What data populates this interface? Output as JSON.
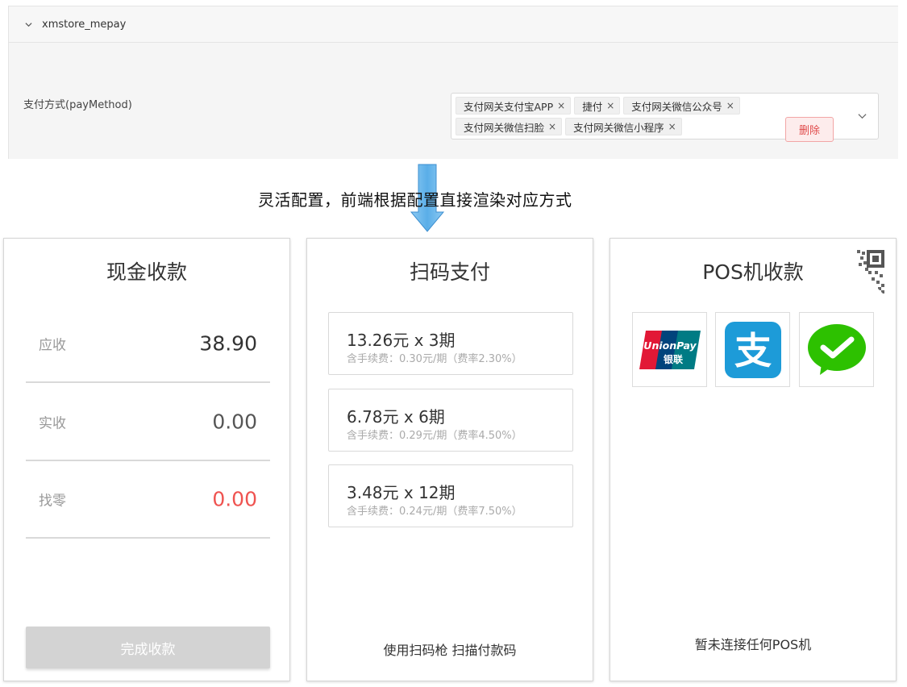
{
  "config": {
    "section_title": "xmstore_mepay",
    "field_label": "支付方式(payMethod)",
    "tags": [
      {
        "label": "支付网关支付宝APP"
      },
      {
        "label": "捷付"
      },
      {
        "label": "支付网关微信公众号"
      },
      {
        "label": "支付网关微信扫脸"
      },
      {
        "label": "支付网关微信小程序"
      }
    ],
    "tag_remove_glyph": "×",
    "delete_label": "删除"
  },
  "caption": "灵活配置，前端根据配置直接渲染对应方式",
  "cash": {
    "title": "现金收款",
    "rows": [
      {
        "label": "应收",
        "value": "38.90"
      },
      {
        "label": "实收",
        "value": "0.00"
      },
      {
        "label": "找零",
        "value": "0.00"
      }
    ],
    "complete_label": "完成收款"
  },
  "scan": {
    "title": "扫码支付",
    "plans": [
      {
        "main": "13.26元 x 3期",
        "sub": "含手续费：0.30元/期（费率2.30%）"
      },
      {
        "main": "6.78元 x 6期",
        "sub": "含手续费：0.29元/期（费率4.50%）"
      },
      {
        "main": "3.48元 x 12期",
        "sub": "含手续费：0.24元/期（费率7.50%）"
      }
    ],
    "footer": "使用扫码枪 扫描付款码"
  },
  "pos": {
    "title": "POS机收款",
    "icons": [
      "unionpay-icon",
      "alipay-icon",
      "wechat-pay-icon"
    ],
    "unionpay_text": "UnionPay",
    "unionpay_cn": "银联",
    "alipay_glyph": "支",
    "footer": "暂未连接任何POS机"
  },
  "colors": {
    "danger": "#e04b4b",
    "change_red": "#ef5350",
    "arrow_blue": "#5aaee8",
    "alipay_blue": "#1d9bd8",
    "wechat_green": "#2dc100"
  }
}
